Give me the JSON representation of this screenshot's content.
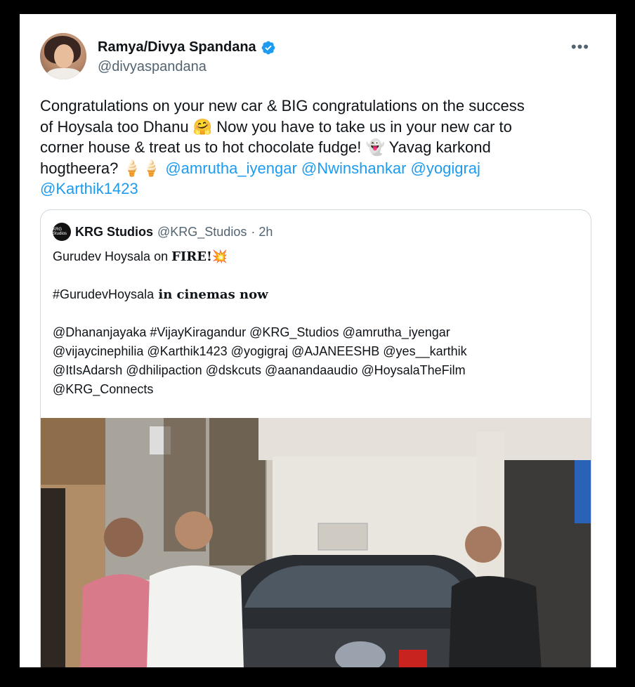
{
  "author": {
    "name": "Ramya/Divya Spandana",
    "handle": "@divyaspandana"
  },
  "more_label": "•••",
  "tweet": {
    "line1": "Congratulations on your new car & BIG congratulations on the success",
    "line2": "of Hoysala too Dhanu 🤗 Now you have to take us in your new car to",
    "line3": "corner house & treat us to hot chocolate fudge! 👻 Yavag karkond",
    "line4_text": "hogtheera? 🍦🍦",
    "mentions": [
      "@amrutha_iyengar",
      "@Nwinshankar",
      "@yogigraj",
      "@Karthik1423"
    ]
  },
  "quote": {
    "logo_text": "KRG Studios",
    "name": "KRG Studios",
    "handle": "@KRG_Studios",
    "time": "· 2h",
    "line1_plain": "Gurudev Hoysala on ",
    "line1_bold": "FIRE!",
    "line1_emoji": "💥",
    "hashtag": "#GurudevHoysala",
    "hashtag_rest": " in cinemas now",
    "tags_line1": "@Dhananjayaka #VijayKiragandur @KRG_Studios @amrutha_iyengar",
    "tags_line2": "@vijaycinephilia @Karthik1423 @yogigraj @AJANEESHB @yes__karthik",
    "tags_line3": "@ItIsAdarsh @dhilipaction @dskcuts @aanandaaudio @HoysalaTheFilm",
    "tags_line4": "@KRG_Connects"
  },
  "colors": {
    "accent": "#1d9bf0",
    "text": "#0f1419",
    "muted": "#536471"
  },
  "icons": [
    "verified-badge-icon",
    "more-options-icon"
  ]
}
